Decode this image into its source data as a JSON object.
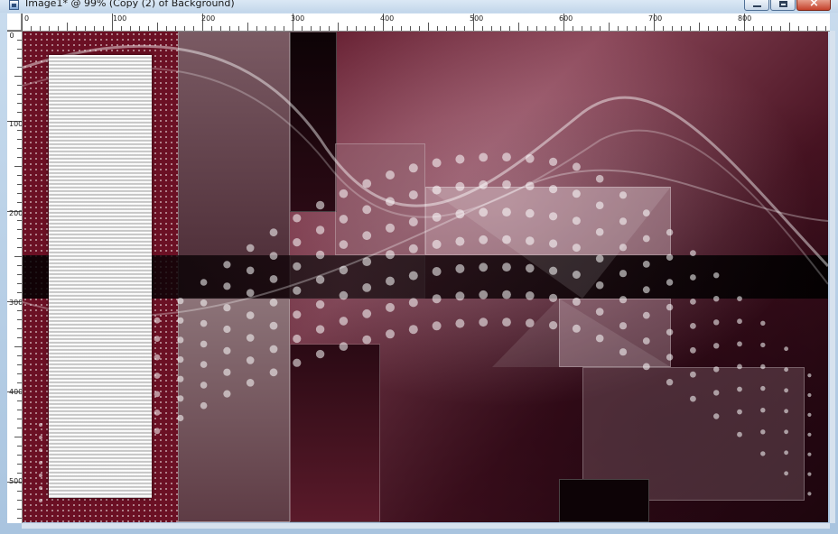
{
  "window": {
    "title": "Image1* @ 99% (Copy (2) of Background)",
    "icon": "image-document-icon",
    "buttons": {
      "minimize": "minimize-icon",
      "maximize": "maximize-icon",
      "close": "close-icon"
    }
  },
  "ruler": {
    "horizontal_labels": [
      "0",
      "100",
      "200",
      "300",
      "400",
      "500",
      "600",
      "700",
      "800"
    ],
    "vertical_labels": [
      "0",
      "100",
      "200",
      "300",
      "400",
      "500"
    ]
  },
  "canvas": {
    "description_colors": {
      "dark_wine": "#3d0e1d",
      "mauve": "#8a4658",
      "deep_red": "#6b1024"
    }
  }
}
